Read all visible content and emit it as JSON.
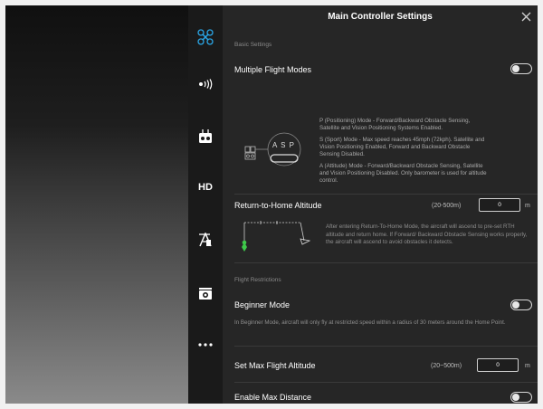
{
  "header": {
    "title": "Main Controller Settings",
    "close_icon": "close-icon"
  },
  "sidebar": {
    "items": [
      {
        "name": "aircraft-icon",
        "active": true,
        "color": "#2aa6e6"
      },
      {
        "name": "signal-icon"
      },
      {
        "name": "remote-controller-icon"
      },
      {
        "name": "hd-icon",
        "label": "HD"
      },
      {
        "name": "battery-icon"
      },
      {
        "name": "camera-icon"
      },
      {
        "name": "more-icon"
      }
    ]
  },
  "basic_settings": {
    "section_label": "Basic Settings",
    "multiple_flight_modes": {
      "title": "Multiple Flight Modes",
      "enabled": false
    },
    "mode_switch": {
      "letters": "A S P"
    },
    "mode_descriptions": [
      "P (Positioning) Mode - Forward/Backward Obstacle Sensing, Satellite and Vision Positioning Systems Enabled.",
      "S (Sport) Mode - Max speed reaches 45mph (72kph). Satellite and Vision Positioning Enabled, Forward and Backward Obstacle Sensing Disabled.",
      "A (Attitude) Mode - Forward/Backward Obstacle Sensing, Satellite and Vision Positioning Disabled. Only barometer is used for altitude control."
    ],
    "rth_altitude": {
      "title": "Return-to-Home Altitude",
      "range": "(20-500m)",
      "value": "0",
      "unit": "m",
      "description": "After entering Return-To-Home Mode, the aircraft will ascend to pre-set RTH altitude and return home. If Forward/ Backward Obstacle Sensing works properly, the aircraft will ascend to avoid obstacles it detects."
    }
  },
  "flight_restrictions": {
    "section_label": "Flight Restrictions",
    "beginner_mode": {
      "title": "Beginner Mode",
      "enabled": false,
      "description": "In Beginner Mode, aircraft will only fly at restricted speed within a radius of 30 meters around the Home Point."
    },
    "max_altitude": {
      "title": "Set Max Flight Altitude",
      "range": "(20~500m)",
      "value": "0",
      "unit": "m"
    },
    "max_distance": {
      "title": "Enable Max Distance",
      "enabled": false
    }
  }
}
